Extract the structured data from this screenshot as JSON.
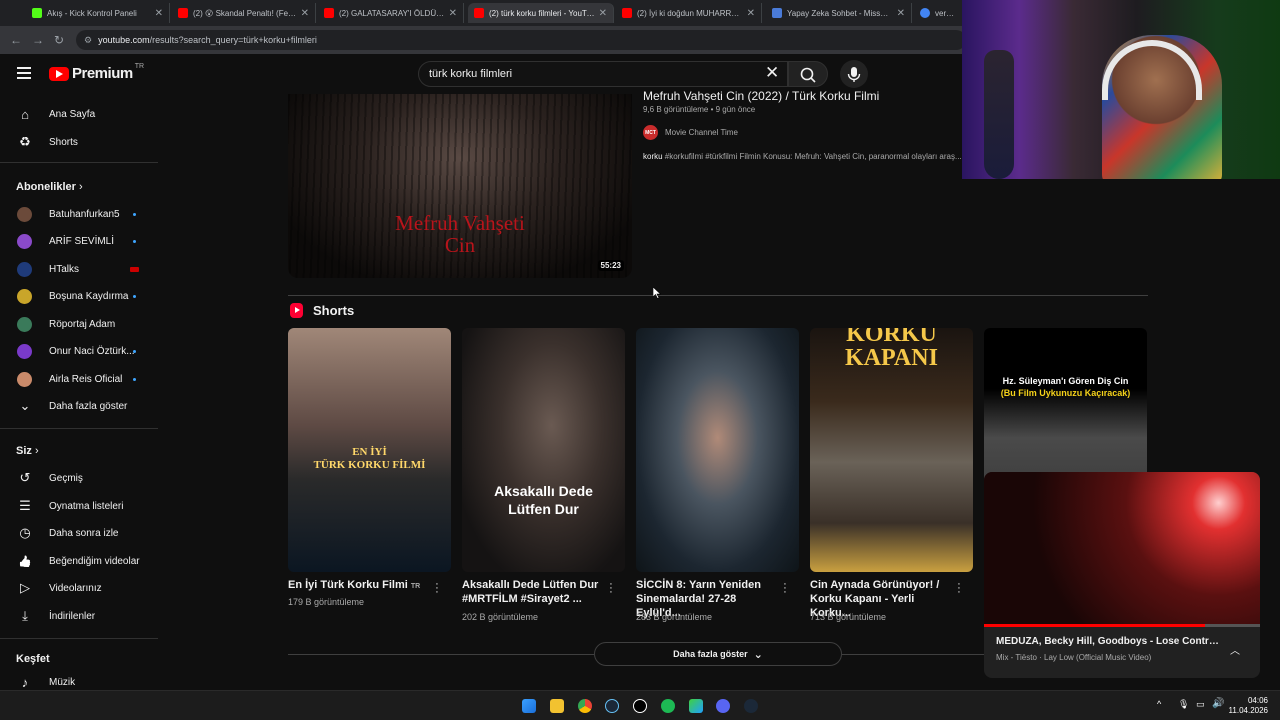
{
  "browser": {
    "tabs": [
      {
        "label": "Akış - Kick Kontrol Paneli",
        "fav_color": "#53fc18"
      },
      {
        "label": "(2) 😮 Skandal Penaltı! (Fenerb...",
        "fav_color": "#ff0000"
      },
      {
        "label": "(2) GALATASARAY'I ÖLDÜ SANA...",
        "fav_color": "#ff0000"
      },
      {
        "label": "(2) türk korku filmleri - YouTube",
        "fav_color": "#ff0000"
      },
      {
        "label": "(2) İyi ki doğdun MUHARREM ...",
        "fav_color": "#ff0000"
      },
      {
        "label": "Yapay Zeka Sohbet - MissXss A...",
        "fav_color": "#4a7bd8"
      },
      {
        "label": "veronic...",
        "fav_color": "#4285f4"
      }
    ],
    "url_host": "youtube.com",
    "url_path": "/results?search_query=türk+korku+filmleri"
  },
  "header": {
    "logo_text": "Premium",
    "country": "TR",
    "search_value": "türk korku filmleri"
  },
  "sidebar": {
    "main": [
      {
        "label": "Ana Sayfa",
        "icon": "⌂"
      },
      {
        "label": "Shorts",
        "icon": "♻"
      }
    ],
    "subs_title": "Abonelikler",
    "subs": [
      {
        "label": "Batuhanfurkan5",
        "color": "#6b4a3a",
        "badge": "dot"
      },
      {
        "label": "ARİF SEVİMLİ",
        "color": "#8a4ac9",
        "badge": "dot"
      },
      {
        "label": "HTalks",
        "color": "#1f3b7a",
        "badge": "live"
      },
      {
        "label": "Boşuna Kaydırma",
        "color": "#c9a52a",
        "badge": "dot"
      },
      {
        "label": "Röportaj Adam",
        "color": "#3a7a5a",
        "badge": ""
      },
      {
        "label": "Onur Naci Öztürk...",
        "color": "#7a3ac9",
        "badge": "dot"
      },
      {
        "label": "Airla Reis Oficial",
        "color": "#c98a6a",
        "badge": "dot"
      },
      {
        "label": "Daha fazla göster",
        "color": "",
        "badge": ""
      }
    ],
    "you_title": "Siz",
    "you": [
      {
        "label": "Geçmiş",
        "icon": "↺"
      },
      {
        "label": "Oynatma listeleri",
        "icon": "☰"
      },
      {
        "label": "Daha sonra izle",
        "icon": "◷"
      },
      {
        "label": "Beğendiğim videolar",
        "icon": "👍"
      },
      {
        "label": "Videolarınız",
        "icon": "▷"
      },
      {
        "label": "İndirilenler",
        "icon": "⤓"
      }
    ],
    "explore_title": "Keşfet",
    "explore": [
      {
        "label": "Müzik",
        "icon": "♪"
      }
    ]
  },
  "video": {
    "thumb_text_line1": "Mefruh Vahşeti",
    "thumb_text_line2": "Cin",
    "duration": "55:23",
    "title": "Mefruh Vahşeti Cin (2022) / Türk Korku Filmi",
    "meta": "9,6 B görüntüleme • 9 gün önce",
    "channel_badge": "MCT",
    "channel": "Movie Channel Time",
    "desc_bold": "korku",
    "desc_rest": " #korkufilmi #türkfilmi Filmin Konusu: Mefruh: Vahşeti Cin, paranormal olayları araş..."
  },
  "shorts": {
    "title": "Shorts",
    "items": [
      {
        "title": "En İyi Türk Korku Filmi",
        "suffix": "TR",
        "views": "179 B görüntüleme",
        "overlay1": "EN İYİ",
        "overlay2": "TÜRK KORKU FİLMİ"
      },
      {
        "title": "Aksakallı Dede Lütfen Dur #MRTFİLM #Sirayet2 ...",
        "suffix": "",
        "views": "202 B görüntüleme",
        "overlay1": "Aksakallı Dede",
        "overlay2": "Lütfen Dur"
      },
      {
        "title": "SİCCİN 8: Yarın Yeniden Sinemalarda! 27-28 Eylül'd...",
        "suffix": "",
        "views": "283 B görüntüleme",
        "overlay1": "",
        "overlay2": ""
      },
      {
        "title": "Cin Aynada Görünüyor! / Korku Kapanı - Yerli Korku...",
        "suffix": "",
        "views": "713 B görüntüleme",
        "overlay1": "KORKU",
        "overlay2": "KAPANI"
      },
      {
        "title": "",
        "suffix": "",
        "views": "",
        "overlay1": "Hz. Süleyman'ı Gören Diş Cin",
        "overlay2": "(Bu Film Uykunuzu Kaçıracak)"
      }
    ],
    "more_label": "Daha fazla göster"
  },
  "miniplayer": {
    "title": "MEDUZA, Becky Hill, Goodboys - Lose Control (O...",
    "subtitle": "Mix - Tiësto · Lay Low (Official Music Video)",
    "progress": 0.8
  },
  "taskbar": {
    "time": "04:06",
    "date": "11.04.2026"
  }
}
